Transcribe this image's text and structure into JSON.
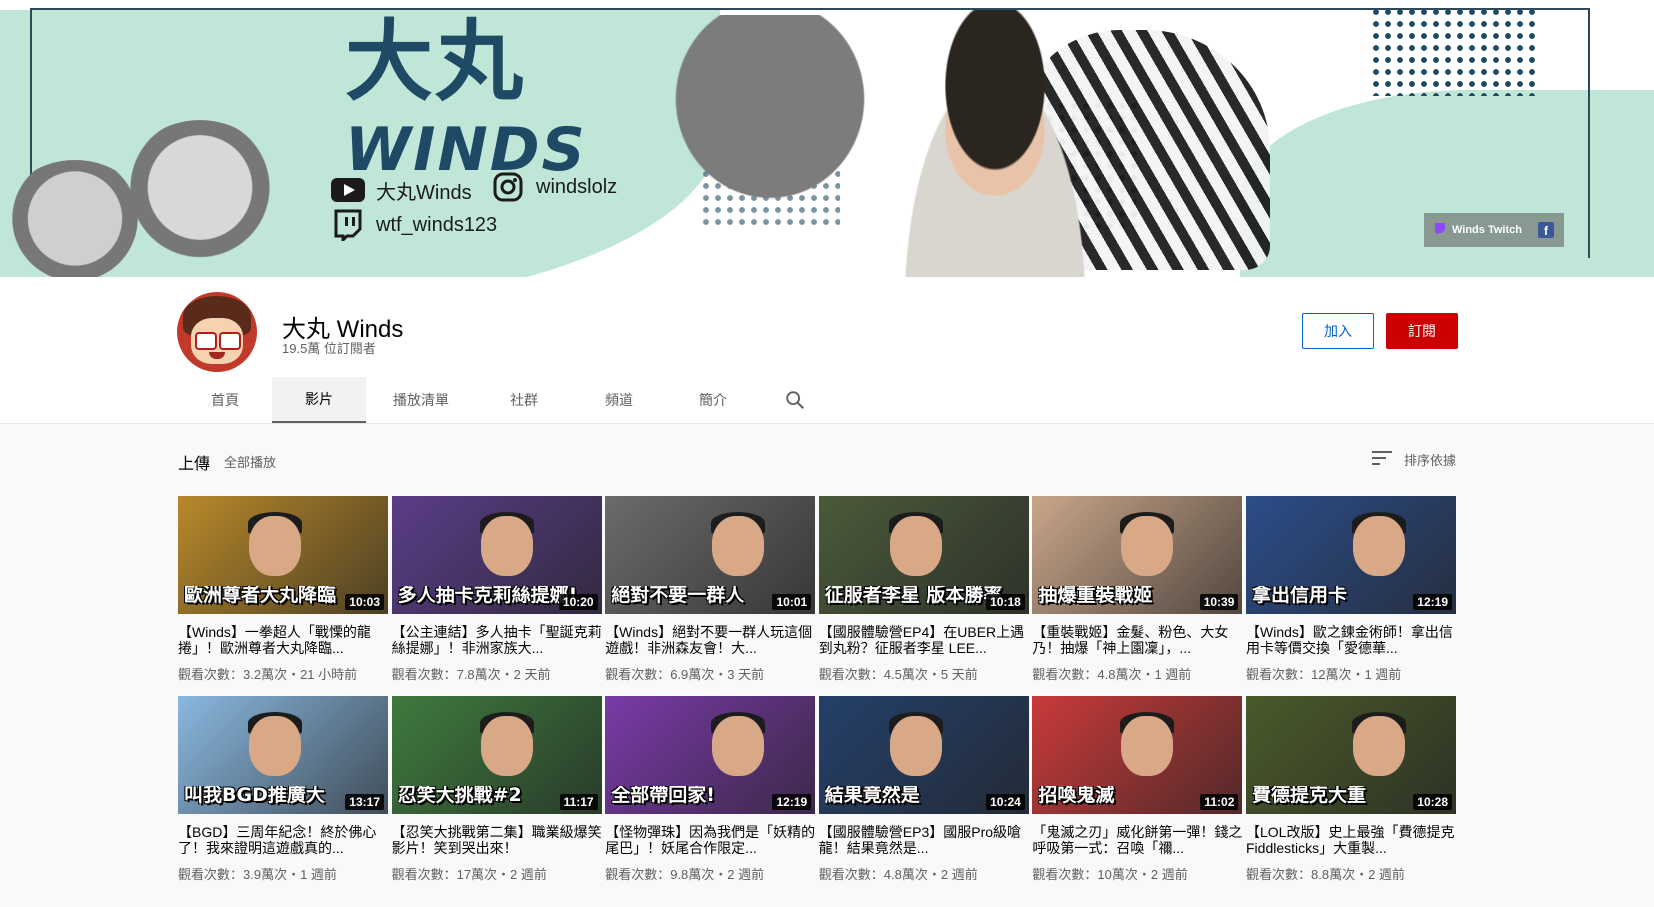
{
  "banner": {
    "title_cn": "大丸",
    "title_en": "WINDS",
    "youtube": "大丸Winds",
    "instagram": "windslolz",
    "twitch": "wtf_winds123",
    "link_chip_label": "Winds Twitch",
    "link_chip_icon": "twitch-icon",
    "facebook_icon": "facebook-icon"
  },
  "channel": {
    "name": "大丸 Winds",
    "subscribers": "19.5萬 位訂閱者",
    "join_label": "加入",
    "subscribe_label": "訂閱"
  },
  "tabs": [
    {
      "label": "首頁"
    },
    {
      "label": "影片"
    },
    {
      "label": "播放清單"
    },
    {
      "label": "社群"
    },
    {
      "label": "頻道"
    },
    {
      "label": "簡介"
    }
  ],
  "active_tab": "影片",
  "section": {
    "title": "上傳",
    "play_all": "全部播放",
    "sort_label": "排序依據"
  },
  "videos": [
    {
      "thumb_text": "歐洲尊者大丸降臨",
      "duration": "10:03",
      "title": "【Winds】一拳超人「戰慄的龍捲」！歐洲尊者大丸降臨...",
      "meta": "觀看次數：3.2萬次・21 小時前",
      "color": "#b8892a"
    },
    {
      "thumb_text": "多人抽卡克莉絲提娜!",
      "duration": "10:20",
      "title": "【公主連結】多人抽卡「聖誕克莉絲提娜」！非洲家族大...",
      "meta": "觀看次數：7.8萬次・2 天前",
      "color": "#5a3d88"
    },
    {
      "thumb_text": "絕對不要一群人",
      "duration": "10:01",
      "title": "【Winds】絕對不要一群人玩這個遊戲！非洲森友會！大...",
      "meta": "觀看次數：6.9萬次・3 天前",
      "color": "#6b6b6b"
    },
    {
      "thumb_text": "征服者李星 版本勝率",
      "duration": "10:18",
      "title": "【國服體驗營EP4】在UBER上遇到丸粉？征服者李星 LEE...",
      "meta": "觀看次數：4.5萬次・5 天前",
      "color": "#4a5a3a"
    },
    {
      "thumb_text": "抽爆重裝戰姬",
      "duration": "10:39",
      "title": "【重裝戰姬】金髮、粉色、大女乃！抽爆「神上園凜」，...",
      "meta": "觀看次數：4.8萬次・1 週前",
      "color": "#c9a68a"
    },
    {
      "thumb_text": "拿出信用卡",
      "duration": "12:19",
      "title": "【Winds】歐之鍊金術師！拿出信用卡等價交換「愛德華...",
      "meta": "觀看次數：12萬次・1 週前",
      "color": "#2c4d8a"
    },
    {
      "thumb_text": "叫我BGD推廣大",
      "duration": "13:17",
      "title": "【BGD】三周年紀念！終於佛心了！我來證明這遊戲真的...",
      "meta": "觀看次數：3.9萬次・1 週前",
      "color": "#8ab8e0"
    },
    {
      "thumb_text": "忍笑大挑戰#2",
      "duration": "11:17",
      "title": "【忍笑大挑戰第二集】職業級爆笑影片！笑到哭出來！",
      "meta": "觀看次數：17萬次・2 週前",
      "color": "#3e7a3e"
    },
    {
      "thumb_text": "全部帶回家!",
      "duration": "12:19",
      "title": "【怪物彈珠】因為我們是「妖精的尾巴」！妖尾合作限定...",
      "meta": "觀看次數：9.8萬次・2 週前",
      "color": "#7a3aa8"
    },
    {
      "thumb_text": "結果竟然是",
      "duration": "10:24",
      "title": "【國服體驗營EP3】國服Pro級嗆龍！結果竟然是...",
      "meta": "觀看次數：4.8萬次・2 週前",
      "color": "#24406a"
    },
    {
      "thumb_text": "招喚鬼滅",
      "duration": "11:02",
      "title": "「鬼滅之刃」威化餅第一彈！錢之呼吸第一式：召喚「禰...",
      "meta": "觀看次數：10萬次・2 週前",
      "color": "#c93a3a"
    },
    {
      "thumb_text": "費德提克大重",
      "duration": "10:28",
      "title": "【LOL改版】史上最強「費德提克 Fiddlesticks」大重製...",
      "meta": "觀看次數：8.8萬次・2 週前",
      "color": "#4a5a2a"
    }
  ]
}
